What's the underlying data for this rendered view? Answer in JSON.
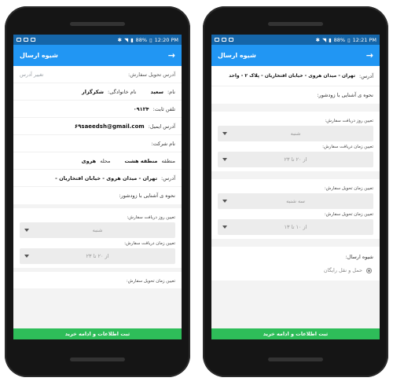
{
  "left": {
    "status": {
      "battery": "88%",
      "time": "12:20 PM"
    },
    "title": "شیوه ارسال",
    "address_header": "آدرس تحویل سفارش:",
    "change_address": "تغییر آدرس",
    "name_label": "نام:",
    "name_value": "سعید",
    "family_label": "نام خانوادگی:",
    "family_value": "شکرگزار",
    "phone_label": "تلفن ثابت:",
    "phone_value": "۰۹۱۲۴",
    "email_label": "آدرس ایمیل:",
    "email_value": "۶۹saeedsh@gmail.com",
    "company_label": "نام شرکت:",
    "region_label": "منطقه",
    "region_value": "منطقه هشت",
    "area_label": "محله",
    "area_value": "هروی",
    "address_label": "آدرس:",
    "address_value": "تهران - میدان هروی - خیابان افتخاریان -",
    "howto_label": "نحوه ی آشنایی با زودشور:",
    "receive_day_label": "تعیین روز دریافت سفارش:",
    "receive_day_value": "شنبه",
    "receive_time_label": "تعیین زمان دریافت سفارش:",
    "receive_time_value": "از ۲۰ تا ۲۳",
    "deliver_time_label": "تعیین زمان تحویل سفارش:",
    "submit": "ثبت اطلاعات و ادامه خرید"
  },
  "right": {
    "status": {
      "battery": "88%",
      "time": "12:21 PM"
    },
    "title": "شیوه ارسال",
    "address_label": "آدرس:",
    "address_value": "تهران - میدان هروی - خیابان افتخاریان - پلاک ۲ - واحد",
    "howto_label": "نحوه ی آشنایی با زودشور:",
    "receive_day_label": "تعیین روز دریافت سفارش:",
    "receive_day_value": "شنبه",
    "receive_time_label": "تعیین زمان دریافت سفارش:",
    "receive_time_value": "از ۲۰ تا ۲۳",
    "deliver_day_label": "تعیین زمان تحویل سفارش:",
    "deliver_day_value": "سه شنبه",
    "deliver_time_label": "تعیین زمان تحویل سفارش:",
    "deliver_time_value": "از ۱۰ تا ۱۳",
    "shipping_label": "شیوه ارسال:",
    "shipping_option": "حمل و نقل رایگان",
    "submit": "ثبت اطلاعات و ادامه خرید"
  }
}
